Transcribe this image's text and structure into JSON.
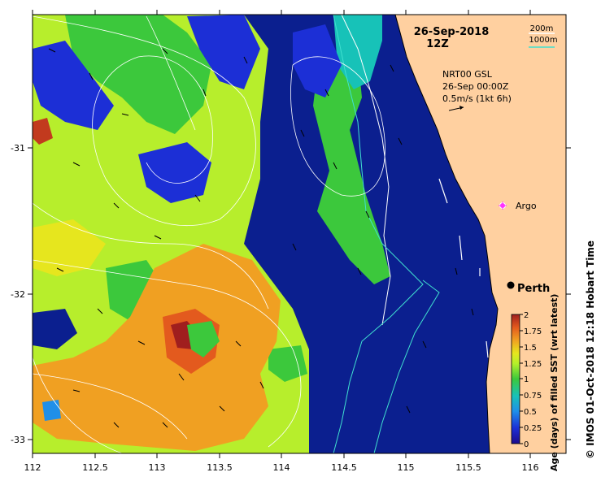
{
  "header": {
    "date": "26-Sep-2018",
    "time": "12Z"
  },
  "depth_legend": {
    "items": [
      {
        "label": "200m",
        "color": "#ffffff"
      },
      {
        "label": "1000m",
        "color": "#40e0d0"
      }
    ]
  },
  "current_legend": {
    "line1": "NRT00 GSL",
    "line2": "26-Sep 00:00Z",
    "line3": "0.5m/s (1kt 6h)"
  },
  "places": {
    "argo": "Argo",
    "perth": "Perth"
  },
  "axes": {
    "x_ticks": [
      "112",
      "112.5",
      "113",
      "113.5",
      "114",
      "114.5",
      "115",
      "115.5",
      "116"
    ],
    "y_ticks": [
      "-31",
      "-32",
      "-33"
    ]
  },
  "colorbar": {
    "title": "Age (days) of filled SST (wrt latest)",
    "ticks": [
      "2",
      "1.75",
      "1.5",
      "1.25",
      "1",
      "0.75",
      "0.5",
      "0.25",
      "0"
    ],
    "colors": [
      "#1c0a8c",
      "#1c2fd6",
      "#1f8fe8",
      "#17c2b8",
      "#3cc83c",
      "#b5f02a",
      "#e6e61e",
      "#f0a022",
      "#e35a1e",
      "#a01e1e"
    ]
  },
  "credit": "© IMOS 01-Oct-2018 12:18 Hobart Time",
  "colors": {
    "land": "#ffd0a0",
    "ocean_recent": "#0b1f8f",
    "frame": "#000000"
  }
}
